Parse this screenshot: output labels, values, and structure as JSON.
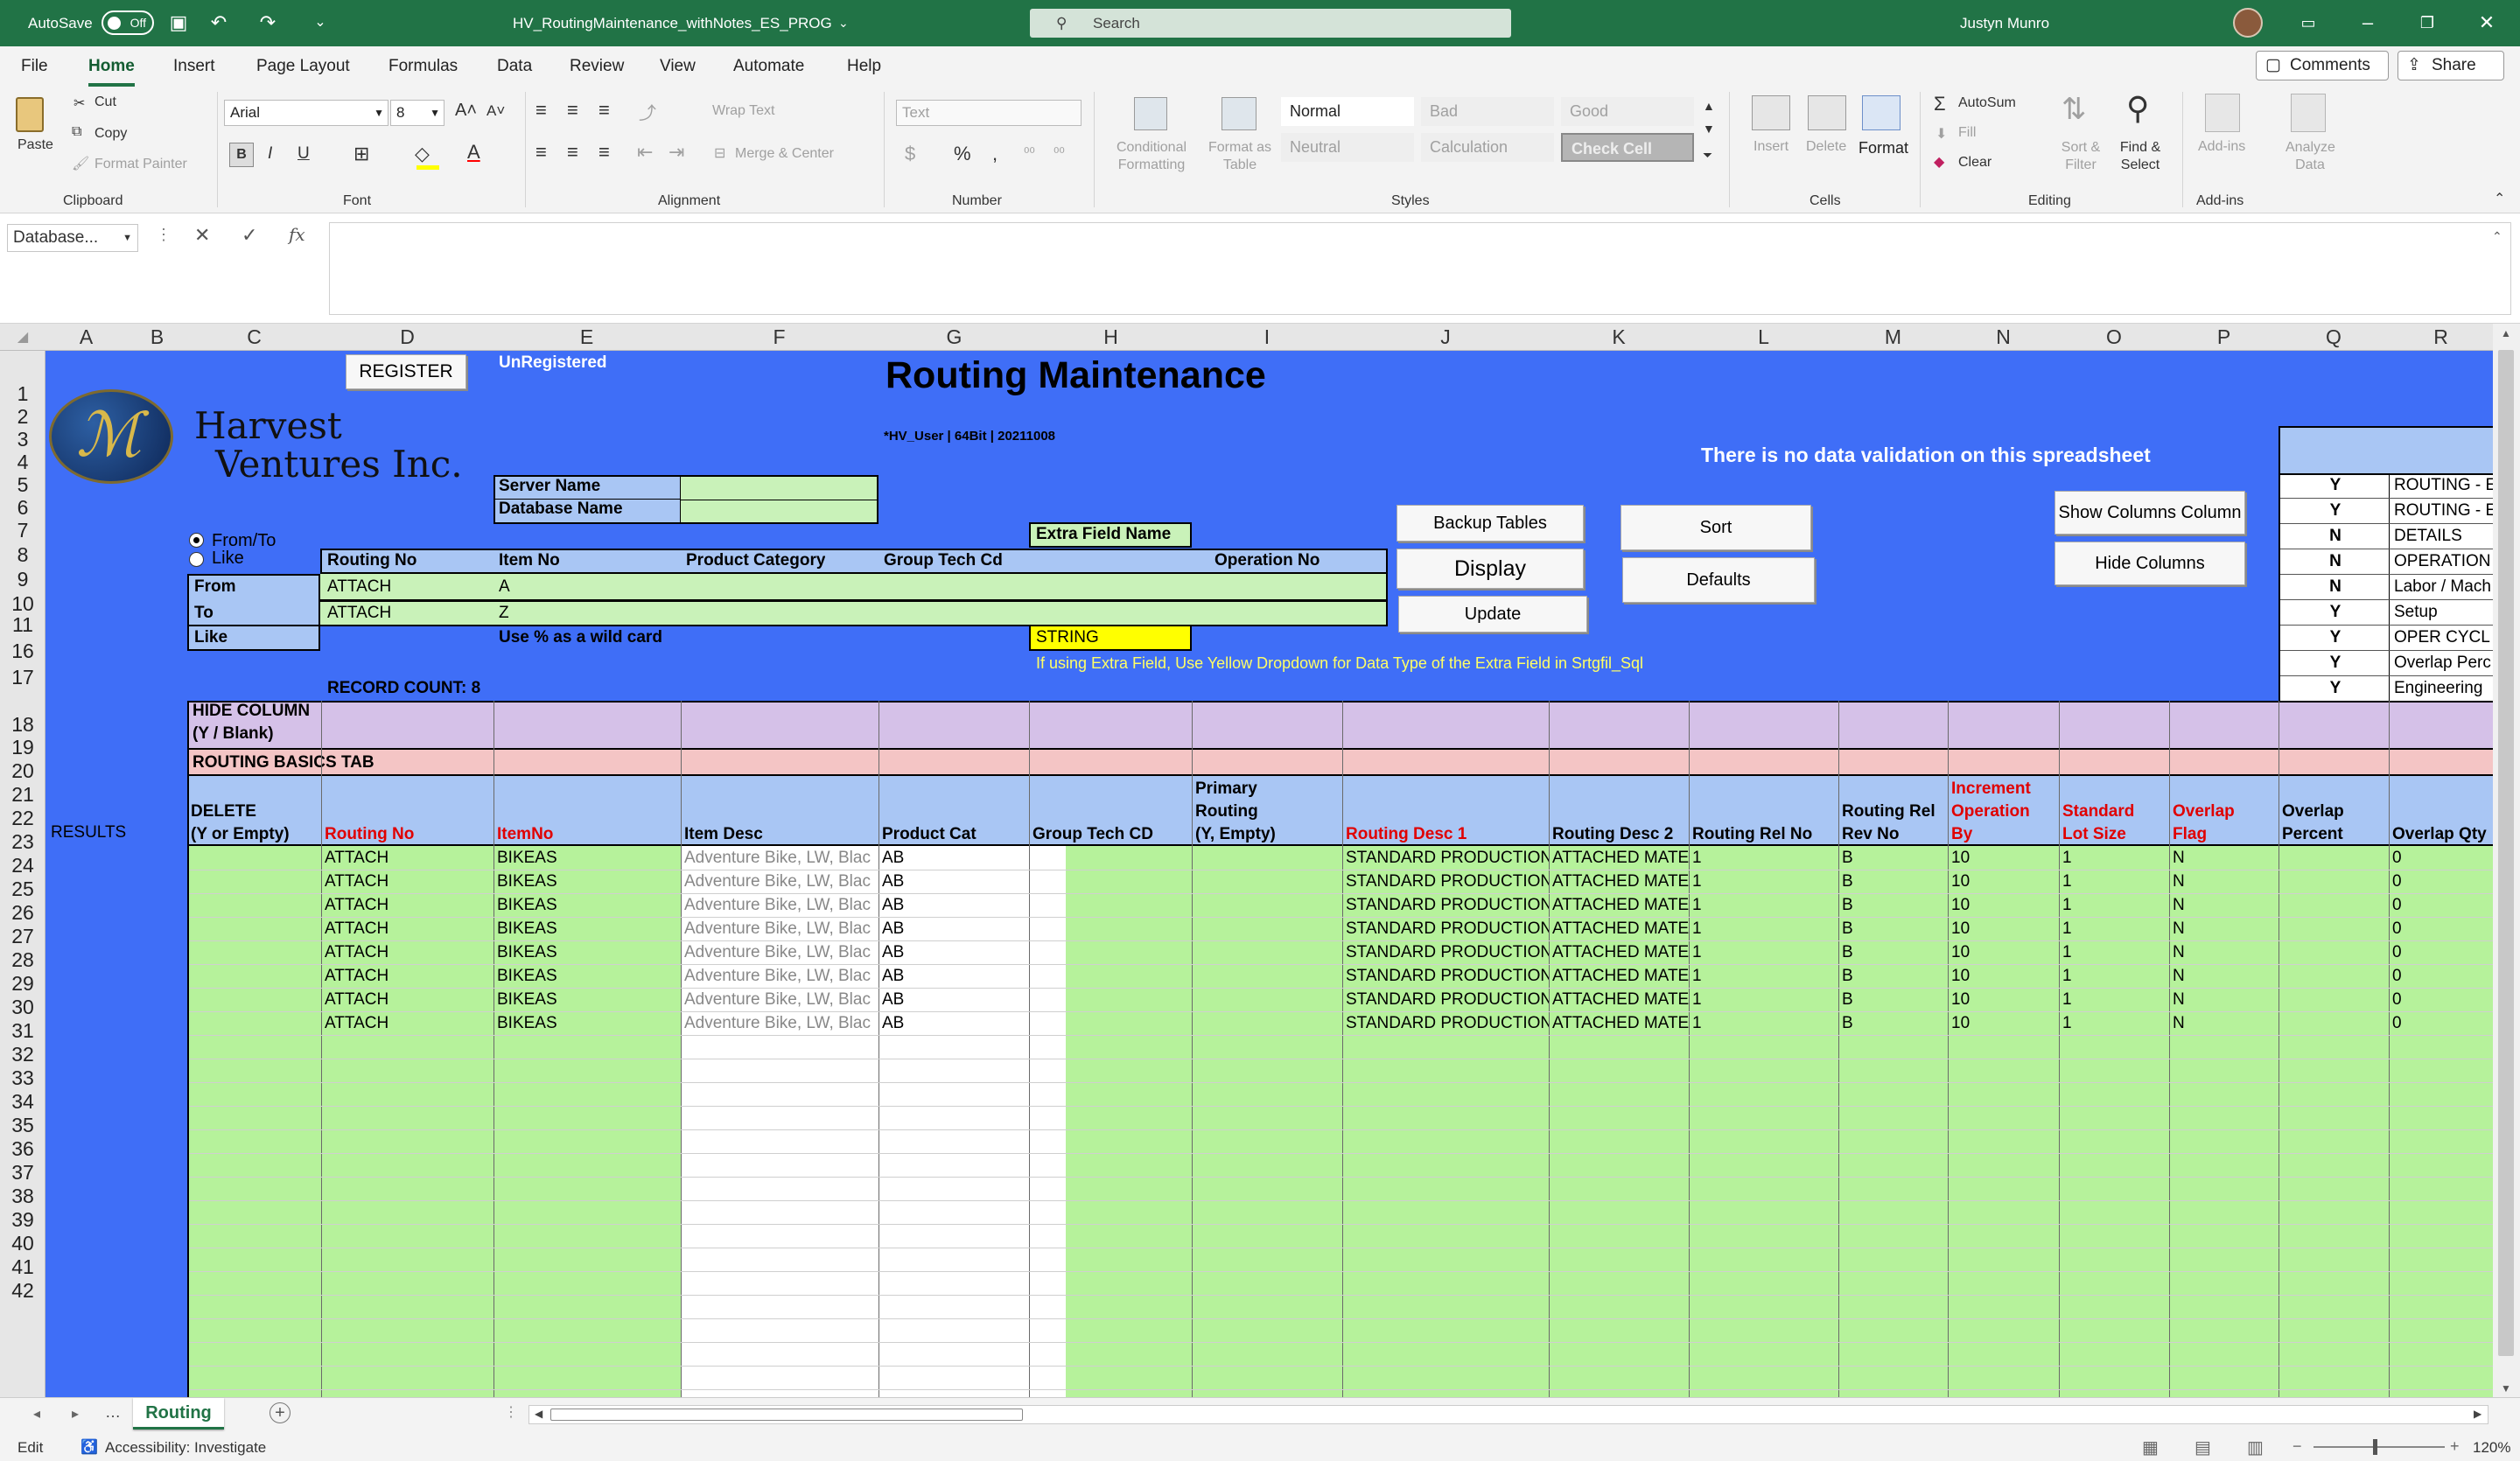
{
  "titlebar": {
    "autosave_label": "AutoSave",
    "autosave_state": "Off",
    "filename": "HV_RoutingMaintenance_withNotes_ES_PROG",
    "search_placeholder": "Search",
    "user": "Justyn Munro"
  },
  "tabs": [
    "File",
    "Home",
    "Insert",
    "Page Layout",
    "Formulas",
    "Data",
    "Review",
    "View",
    "Automate",
    "Help"
  ],
  "active_tab": "Home",
  "ribbon_right": {
    "comments": "Comments",
    "share": "Share"
  },
  "clipboard": {
    "paste": "Paste",
    "cut": "Cut",
    "copy": "Copy",
    "format_painter": "Format Painter",
    "group": "Clipboard"
  },
  "font": {
    "name": "Arial",
    "size": "8",
    "bold": "B",
    "italic": "I",
    "underline": "U",
    "group": "Font"
  },
  "alignment": {
    "wrap": "Wrap Text",
    "merge": "Merge & Center",
    "group": "Alignment"
  },
  "number": {
    "format": "Text",
    "currency": "$",
    "percent": "%",
    "comma": ",",
    "group": "Number"
  },
  "styles": {
    "cond": "Conditional Formatting",
    "table": "Format as Table",
    "normal": "Normal",
    "bad": "Bad",
    "good": "Good",
    "neutral": "Neutral",
    "calculation": "Calculation",
    "check": "Check Cell",
    "group": "Styles"
  },
  "cells": {
    "insert": "Insert",
    "delete": "Delete",
    "format": "Format",
    "group": "Cells"
  },
  "editing": {
    "autosum": "AutoSum",
    "fill": "Fill",
    "clear": "Clear",
    "sort": "Sort & Filter",
    "find": "Find & Select",
    "group": "Editing"
  },
  "addins": {
    "addins": "Add-ins",
    "analyze": "Analyze Data",
    "group": "Add-ins"
  },
  "namebox": "Database...",
  "columns": [
    "A",
    "B",
    "C",
    "D",
    "E",
    "F",
    "G",
    "H",
    "I",
    "J",
    "K",
    "L",
    "M",
    "N",
    "O",
    "P",
    "Q",
    "R"
  ],
  "rows": [
    "1",
    "2",
    "3",
    "4",
    "5",
    "6",
    "7",
    "8",
    "9",
    "10",
    "11",
    "16",
    "17",
    "18",
    "19",
    "20",
    "21",
    "22",
    "23",
    "24",
    "25",
    "26",
    "27",
    "28",
    "29",
    "30",
    "31",
    "32",
    "33",
    "34",
    "35",
    "36",
    "37",
    "38",
    "39",
    "40",
    "41",
    "42"
  ],
  "sheet": {
    "register": "REGISTER",
    "unregistered": "UnRegistered",
    "title": "Routing Maintenance",
    "company_line1": "Harvest",
    "company_line2": "Ventures Inc.",
    "version": "*HV_User | 64Bit | 20211008",
    "no_validation": "There is no data validation on this spreadsheet",
    "server_name": "Server Name",
    "database_name": "Database Name",
    "extra_field_name": "Extra Field Name",
    "radio_fromto": "From/To",
    "radio_like": "Like",
    "filter_headers": [
      "Routing No",
      "Item No",
      "Product Category",
      "Group Tech Cd",
      "",
      "Operation No"
    ],
    "from_label": "From",
    "to_label": "To",
    "like_label": "Like",
    "from_vals": [
      "ATTACH",
      "A"
    ],
    "to_vals": [
      "ATTACH",
      "Z"
    ],
    "wildcard": "Use % as a wild card",
    "string": "STRING",
    "extra_hint": "If using Extra Field, Use Yellow Dropdown for Data Type of the Extra Field in Srtgfil_Sql",
    "record_count": "RECORD COUNT:  8",
    "buttons": {
      "backup": "Backup Tables",
      "display": "Display",
      "update": "Update",
      "sort": "Sort",
      "defaults": "Defaults",
      "show_cols": "Show Columns Column",
      "hide_cols": "Hide Columns"
    },
    "side_flags": [
      [
        "Y",
        "ROUTING - E"
      ],
      [
        "Y",
        "ROUTING - E"
      ],
      [
        "N",
        "DETAILS"
      ],
      [
        "N",
        "OPERATION"
      ],
      [
        "N",
        "Labor / Mach"
      ],
      [
        "Y",
        "Setup"
      ],
      [
        "Y",
        "OPER CYCL"
      ],
      [
        "Y",
        "Overlap Perc"
      ],
      [
        "Y",
        "Engineering"
      ]
    ],
    "hide_column": "HIDE COLUMN",
    "hide_column2": "(Y / Blank)",
    "routing_basics": "ROUTING BASICS TAB",
    "results": "RESULTS",
    "result_headers": [
      "DELETE\n(Y or Empty)",
      "Routing No",
      "ItemNo",
      "Item Desc",
      "Product Cat",
      "Group Tech CD",
      "Primary\nRouting\n(Y, Empty)",
      "Routing Desc 1",
      "Routing Desc 2",
      "Routing Rel No",
      "Routing Rel\nRev No",
      "Increment\nOperation\nBy",
      "Standard\nLot Size",
      "Overlap\nFlag",
      "Overlap\nPercent",
      "Overlap Qty"
    ],
    "result_row": [
      "",
      "ATTACH",
      "BIKEAS",
      "Adventure Bike, LW, Blac",
      "AB",
      "",
      "",
      "STANDARD PRODUCTION",
      "ATTACHED MATE",
      "1",
      "B",
      "10",
      "1",
      "N",
      "",
      "0"
    ],
    "result_count": 8
  },
  "sheet_tab": "Routing",
  "status": {
    "mode": "Edit",
    "accessibility": "Accessibility: Investigate",
    "zoom": "120%"
  }
}
